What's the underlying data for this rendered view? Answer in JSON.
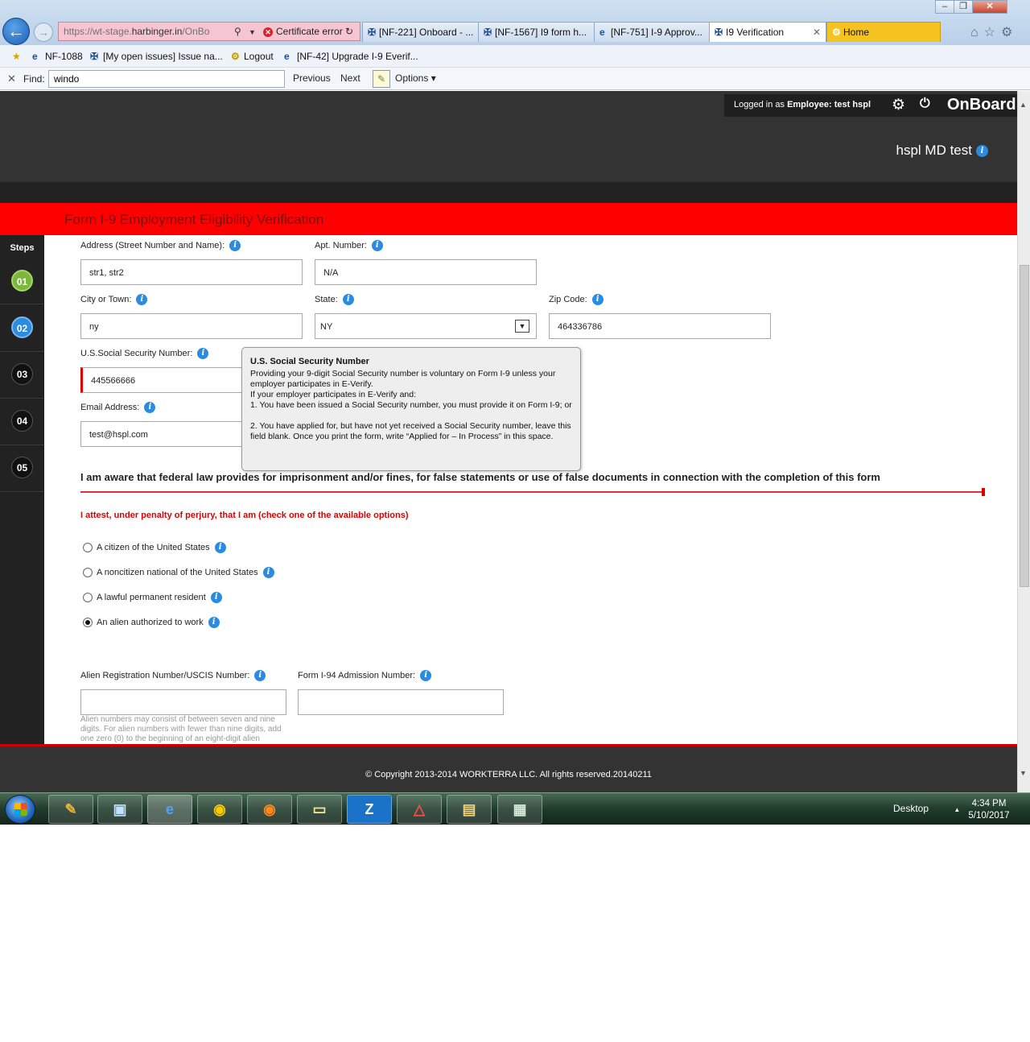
{
  "browser": {
    "url_prefix": "https://wt-stage.",
    "url_domain": "harbinger.in",
    "url_suffix": "/OnBo",
    "cert_error": "Certificate error",
    "tabs": [
      {
        "label": "[NF-221] Onboard - ..."
      },
      {
        "label": "[NF-1567] I9 form h..."
      },
      {
        "label": "[NF-751] I-9 Approv..."
      },
      {
        "label": "I9 Verification"
      },
      {
        "label": "Home"
      }
    ],
    "favorites": [
      {
        "label": "NF-1088"
      },
      {
        "label": "[My open issues] Issue na..."
      },
      {
        "label": "Logout"
      },
      {
        "label": "[NF-42] Upgrade I-9 Everif..."
      }
    ],
    "find": {
      "label": "Find:",
      "value": "windo",
      "previous": "Previous",
      "next": "Next",
      "options": "Options"
    }
  },
  "header": {
    "logged_in_prefix": "Logged in as",
    "logged_in_role": "Employee:",
    "logged_in_user": "test hspl",
    "brand": "OnBoard",
    "org_name": "hspl MD test",
    "form_title": "Form I-9 Employment Eligibility Verification"
  },
  "steps": {
    "label": "Steps",
    "items": [
      "01",
      "02",
      "03",
      "04",
      "05"
    ]
  },
  "form": {
    "address_label": "Address (Street Number and Name):",
    "address_value": "str1, str2",
    "apt_label": "Apt. Number:",
    "apt_value": "N/A",
    "city_label": "City or Town:",
    "city_value": "ny",
    "state_label": "State:",
    "state_value": "NY",
    "zip_label": "Zip Code:",
    "zip_value": "464336786",
    "ssn_label": "U.S.Social Security Number:",
    "ssn_value": "445566666",
    "email_label": "Email Address:",
    "email_value": "test@hspl.com",
    "warning": "I am aware that federal law provides for imprisonment and/or fines, for false statements or use of false documents in connection with the completion of this form",
    "attest": "I attest, under penalty of perjury, that I am (check one of the available options)",
    "options": [
      {
        "label": "A citizen of the United States"
      },
      {
        "label": "A noncitizen national of the United States"
      },
      {
        "label": "A lawful permanent resident"
      },
      {
        "label": "An alien authorized to work"
      }
    ],
    "alien_label": "Alien Registration Number/USCIS Number:",
    "i94_label": "Form I-94 Admission Number:",
    "alien_hint": "Alien numbers may consist of between seven and nine digits. For alien numbers with fewer than nine digits, add one zero (0) to the beginning of an eight-digit alien"
  },
  "tooltip": {
    "title": "U.S. Social Security Number",
    "line1": "Providing your 9-digit Social Security number is voluntary on Form I-9 unless your employer participates in E-Verify.",
    "line2": "If your employer participates in E-Verify and:",
    "line3": "1. You have been issued a Social Security number, you must provide it on Form I-9; or",
    "line4": "2. You have applied for, but have not yet received a Social Security number, leave this field blank. Once you print the form, write “Applied for – In Process” in this space."
  },
  "footer": {
    "copyright": "© Copyright 2013-2014 WORKTERRA LLC. All rights reserved.20140211"
  },
  "taskbar": {
    "desktop_label": "Desktop",
    "time": "4:34 PM",
    "date": "5/10/2017"
  }
}
